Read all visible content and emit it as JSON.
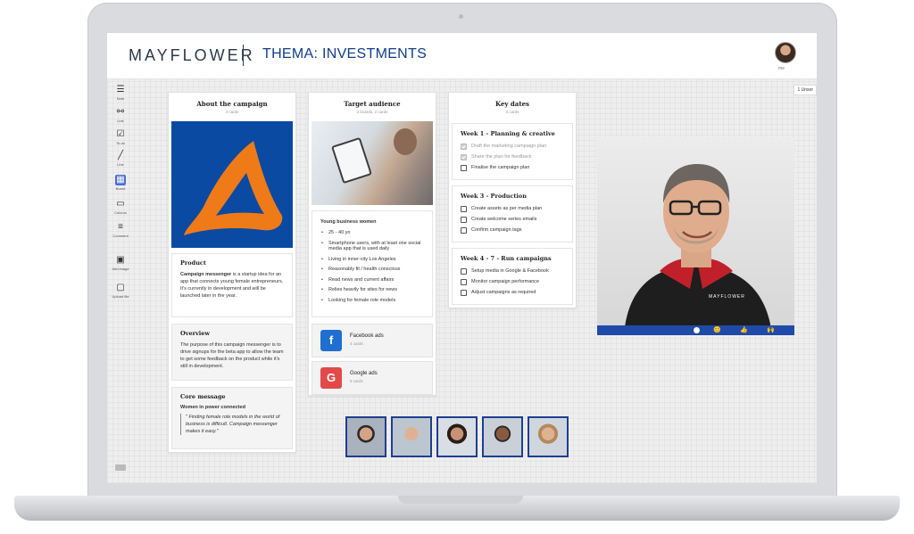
{
  "header": {
    "logo": "MAYFLOWER",
    "board_title": "THEMA: INVESTMENTS",
    "user_label": "me"
  },
  "unsorted_label": "1 Unsor",
  "toolbar": {
    "items": [
      {
        "label": "Note",
        "icon": "note-icon"
      },
      {
        "label": "Link",
        "icon": "link-icon"
      },
      {
        "label": "To-do",
        "icon": "todo-icon"
      },
      {
        "label": "Line",
        "icon": "line-icon"
      },
      {
        "label": "Board",
        "icon": "board-icon"
      },
      {
        "label": "Column",
        "icon": "column-icon"
      },
      {
        "label": "Comment",
        "icon": "comment-icon"
      },
      {
        "label": "Add image",
        "icon": "image-icon"
      },
      {
        "label": "Upload file",
        "icon": "upload-icon"
      }
    ]
  },
  "columns": {
    "about": {
      "title": "About the campaign",
      "subtitle": "4 cards",
      "product": {
        "heading": "Product",
        "bold": "Campaign messenger",
        "text": " is a startup idea for an app that connects young female entrepreneurs. It's currently in development and will be launched later in the year."
      },
      "overview": {
        "heading": "Overview",
        "text": "The purpose of this campaign messenger is to drive signups for the beta app to allow the team to get some feedback on the product while it's still in development."
      },
      "core": {
        "heading": "Core message",
        "bold": "Women in power connected",
        "quote": "\" Finding female role models in the world of business is difficult. Campaign messenger makes it easy.\""
      }
    },
    "target": {
      "title": "Target audience",
      "subtitle": "2 boards, 2 cards",
      "list_heading": "Young business women",
      "items": [
        "25 - 40 yo",
        "Smartphone users, with at least one social media app that is used daily",
        "Living in inner-city Los Angeles",
        "Reasonably fit / health conscious",
        "Read news and current affairs",
        "Relies heavily for sites for news",
        "Looking for female role models"
      ],
      "boards": [
        {
          "name": "Facebook ads",
          "count": "4 cards",
          "glyph": "f",
          "color": "#1f6fd0"
        },
        {
          "name": "Google ads",
          "count": "5 cards",
          "glyph": "G",
          "color": "#e24a4a"
        }
      ]
    },
    "dates": {
      "title": "Key dates",
      "subtitle": "3 cards",
      "weeks": [
        {
          "heading": "Week 1 - Planning & creative",
          "tasks": [
            {
              "text": "Draft the marketing campaign plan",
              "done": true
            },
            {
              "text": "Share the plan for feedback",
              "done": true
            },
            {
              "text": "Finalise the campaign plan",
              "done": false
            }
          ]
        },
        {
          "heading": "Week 3 - Production",
          "tasks": [
            {
              "text": "Create assets as per media plan",
              "done": false
            },
            {
              "text": "Create welcome series emails",
              "done": false
            },
            {
              "text": "Confirm campaign tags",
              "done": false
            }
          ]
        },
        {
          "heading": "Week 4 - 7 - Run campaigns",
          "tasks": [
            {
              "text": "Setup media in Google & Facebook",
              "done": false
            },
            {
              "text": "Monitor campaign performance",
              "done": false
            },
            {
              "text": "Adjust campaigns as required",
              "done": false
            }
          ]
        }
      ]
    }
  },
  "video": {
    "hoodie_text": "MAYFLOWER",
    "reactions": [
      "😊",
      "👍",
      "🙌"
    ]
  },
  "participants": [
    {
      "name": "participant-1"
    },
    {
      "name": "participant-2"
    },
    {
      "name": "participant-3"
    },
    {
      "name": "participant-4"
    },
    {
      "name": "participant-5"
    }
  ],
  "colors": {
    "brand_blue": "#123d88",
    "accent_orange": "#ee7a18",
    "video_bar": "#1f4aa8"
  }
}
